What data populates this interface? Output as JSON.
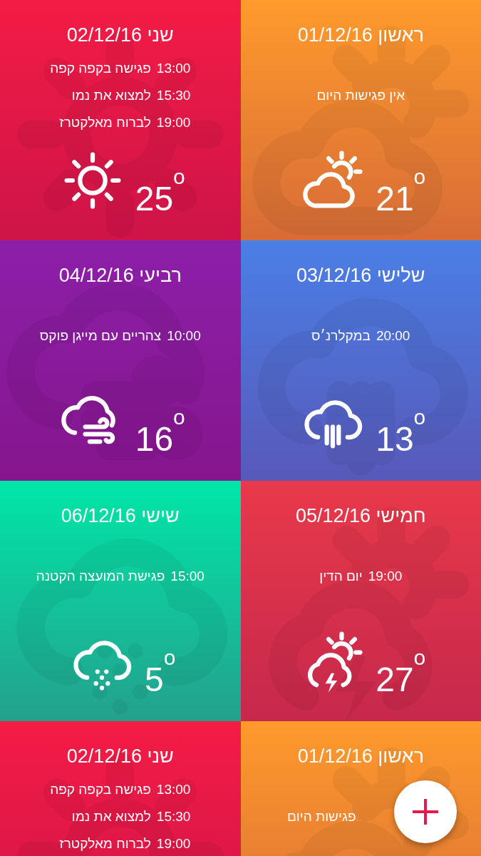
{
  "tiles": [
    {
      "day": "ראשון",
      "date": "01/12/16",
      "color": "#ff9a2c",
      "kind": "partly_cloudy",
      "none_text": "אין פגישות היום",
      "temperature": "21$^{o}$"
    },
    {
      "day": "שני",
      "date": "02/12/16",
      "color": "#f31c45",
      "kind": "sunny",
      "meetings": [
        {
          "time": "13:00",
          "title": "פגישה בקפה קפה"
        },
        {
          "time": "15:30",
          "title": "למצוא את נמו"
        },
        {
          "time": "19:00",
          "title": "לברוח מאלקטרז"
        }
      ],
      "temperature": "25$^{o}$"
    },
    {
      "day": "שלישי",
      "date": "03/12/16",
      "color": "#4a7fe6",
      "kind": "rain",
      "meetings": [
        {
          "time": "20:00",
          "title": "במקלרנ׳ס"
        }
      ],
      "temperature": "13$^{o}$"
    },
    {
      "day": "רביעי",
      "date": "04/12/16",
      "color": "#8c1fa8",
      "kind": "wind",
      "meetings": [
        {
          "time": "10:00",
          "title": "צהריים עם מייגן פוקס"
        }
      ],
      "temperature": "16$^{o}$"
    },
    {
      "day": "חמישי",
      "date": "05/12/16",
      "color": "#e8394a",
      "kind": "thunder",
      "meetings": [
        {
          "time": "19:00",
          "title": "יום הדין"
        }
      ],
      "temperature": "27$^{o}$"
    },
    {
      "day": "שישי",
      "date": "06/12/16",
      "color": "#00e6a8",
      "kind": "snow",
      "meetings": [
        {
          "time": "15:00",
          "title": "פגישת המועצה הקטנה"
        }
      ],
      "temperature": "5$^{o}$"
    },
    {
      "day": "ראשון",
      "date": "01/12/16",
      "color": "#ff9a2c",
      "kind": "partly_cloudy",
      "none_text": "פגישות היום"
    },
    {
      "day": "שני",
      "date": "02/12/16",
      "color": "#f31c45",
      "kind": "sunny",
      "meetings": [
        {
          "time": "13:00",
          "title": "פגישה בקפה קפה"
        },
        {
          "time": "15:30",
          "title": "למצוא את נמו"
        },
        {
          "time": "19:00",
          "title": "לברוח מאלקטרז"
        }
      ]
    }
  ],
  "add_button": {
    "kind": "plus"
  }
}
